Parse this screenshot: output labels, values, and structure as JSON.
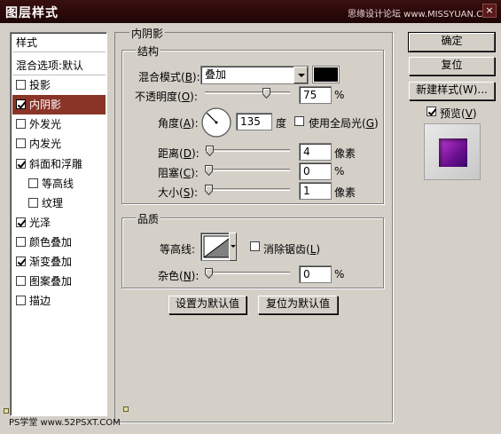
{
  "window": {
    "title": "图层样式",
    "watermark": "思缘设计论坛 www.MISSYUAN.COM",
    "close_glyph": "×"
  },
  "style_list": {
    "header": "样式",
    "items": [
      {
        "label": "混合选项:默认",
        "checkbox": false,
        "checked": false,
        "selected": false,
        "indent": false
      },
      {
        "label": "投影",
        "checkbox": true,
        "checked": false,
        "selected": false,
        "indent": false
      },
      {
        "label": "内阴影",
        "checkbox": true,
        "checked": true,
        "selected": true,
        "indent": false
      },
      {
        "label": "外发光",
        "checkbox": true,
        "checked": false,
        "selected": false,
        "indent": false
      },
      {
        "label": "内发光",
        "checkbox": true,
        "checked": false,
        "selected": false,
        "indent": false
      },
      {
        "label": "斜面和浮雕",
        "checkbox": true,
        "checked": true,
        "selected": false,
        "indent": false
      },
      {
        "label": "等高线",
        "checkbox": true,
        "checked": false,
        "selected": false,
        "indent": true
      },
      {
        "label": "纹理",
        "checkbox": true,
        "checked": false,
        "selected": false,
        "indent": true
      },
      {
        "label": "光泽",
        "checkbox": true,
        "checked": true,
        "selected": false,
        "indent": false
      },
      {
        "label": "颜色叠加",
        "checkbox": true,
        "checked": false,
        "selected": false,
        "indent": false
      },
      {
        "label": "渐变叠加",
        "checkbox": true,
        "checked": true,
        "selected": false,
        "indent": false
      },
      {
        "label": "图案叠加",
        "checkbox": true,
        "checked": false,
        "selected": false,
        "indent": false
      },
      {
        "label": "描边",
        "checkbox": true,
        "checked": false,
        "selected": false,
        "indent": false
      }
    ]
  },
  "inner_shadow": {
    "section_title": "内阴影",
    "structure": {
      "title": "结构",
      "blend_mode_label": "混合模式(",
      "blend_mode_key": "B",
      "blend_mode_value": "叠加",
      "shadow_color": "#000000",
      "opacity_label": "不透明度(",
      "opacity_key": "O",
      "opacity_value": "75",
      "opacity_fraction": 0.75,
      "opacity_unit": "%",
      "angle_label": "角度(",
      "angle_key": "A",
      "angle_value": "135",
      "angle_degrees": 135,
      "angle_unit": "度",
      "global_light_label": "使用全局光(",
      "global_light_key": "G",
      "global_light_checked": false,
      "distance_label": "距离(",
      "distance_key": "D",
      "distance_value": "4",
      "distance_fraction": 0.016,
      "distance_unit": "像素",
      "choke_label": "阻塞(",
      "choke_key": "C",
      "choke_value": "0",
      "choke_fraction": 0,
      "choke_unit": "%",
      "size_label": "大小(",
      "size_key": "S",
      "size_value": "1",
      "size_fraction": 0.004,
      "size_unit": "像素"
    },
    "quality": {
      "title": "品质",
      "contour_label": "等高线:",
      "anti_alias_label": "消除锯齿(",
      "anti_alias_key": "L",
      "anti_alias_checked": false,
      "noise_label": "杂色(",
      "noise_key": "N",
      "noise_value": "0",
      "noise_fraction": 0,
      "noise_unit": "%"
    },
    "make_default_label": "设置为默认值",
    "reset_default_label": "复位为默认值"
  },
  "right_panel": {
    "ok_label": "确定",
    "reset_label": "复位",
    "new_style_label": "新建样式(W)...",
    "preview_label": "预览(",
    "preview_key": "V",
    "preview_checked": true
  },
  "footer": {
    "watermark": "PS学堂 www.52PSXT.COM"
  },
  "colors": {
    "selected_item": "#8a3428",
    "title_bar": "#2a0808",
    "dialog_bg": "#d4d0c8",
    "preview_swatch": "#8a1fb0"
  }
}
